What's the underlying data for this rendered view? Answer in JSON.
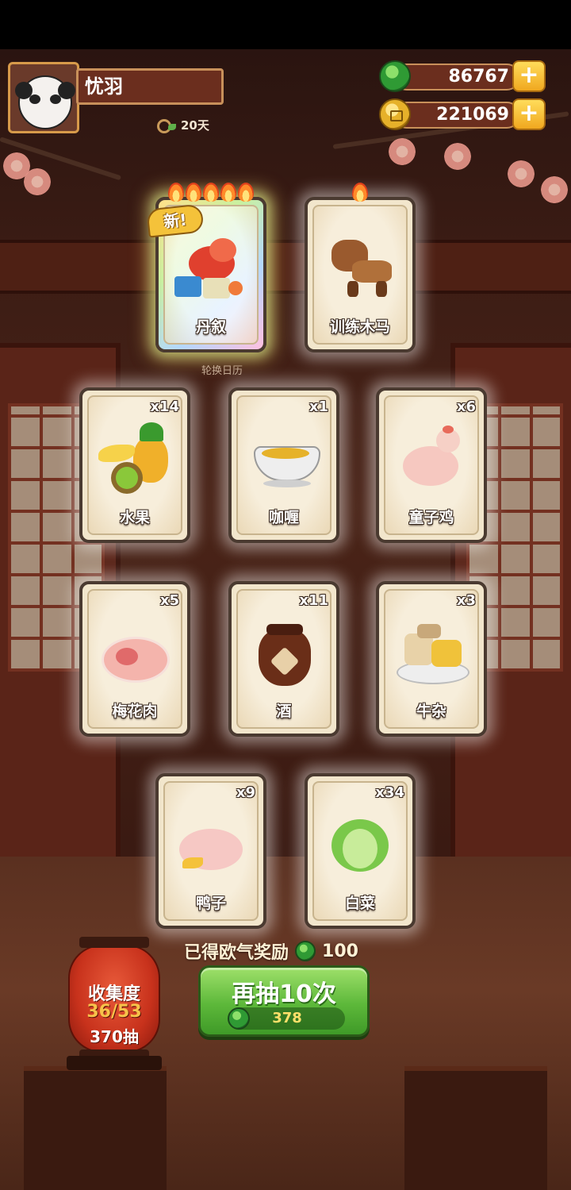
{
  "player": {
    "name": "忧羽",
    "days": "20天"
  },
  "currency": {
    "jade": "86767",
    "coins": "221069",
    "plus": "+"
  },
  "featured_cards": [
    {
      "name": "丹叙",
      "badge": "新!",
      "flames": 5,
      "rarity": "rainbow"
    },
    {
      "name": "训练木马",
      "flames": 1
    }
  ],
  "calendar_label": "轮换日历",
  "cards": [
    {
      "name": "水果",
      "count": "x14"
    },
    {
      "name": "咖喱",
      "count": "x1"
    },
    {
      "name": "童子鸡",
      "count": "x6"
    },
    {
      "name": "梅花肉",
      "count": "x5"
    },
    {
      "name": "酒",
      "count": "x11"
    },
    {
      "name": "牛杂",
      "count": "x3"
    },
    {
      "name": "鸭子",
      "count": "x9"
    },
    {
      "name": "白菜",
      "count": "x34"
    }
  ],
  "reward": {
    "label": "已得欧气奖励",
    "value": "100"
  },
  "draw_button": {
    "label": "再抽10次",
    "cost": "378"
  },
  "collection": {
    "title": "收集度",
    "progress": "36/53",
    "draws": "370抽"
  },
  "colors": {
    "accent_green": "#5db83a",
    "gold": "#f0a820",
    "wood": "#6b2e1e"
  }
}
